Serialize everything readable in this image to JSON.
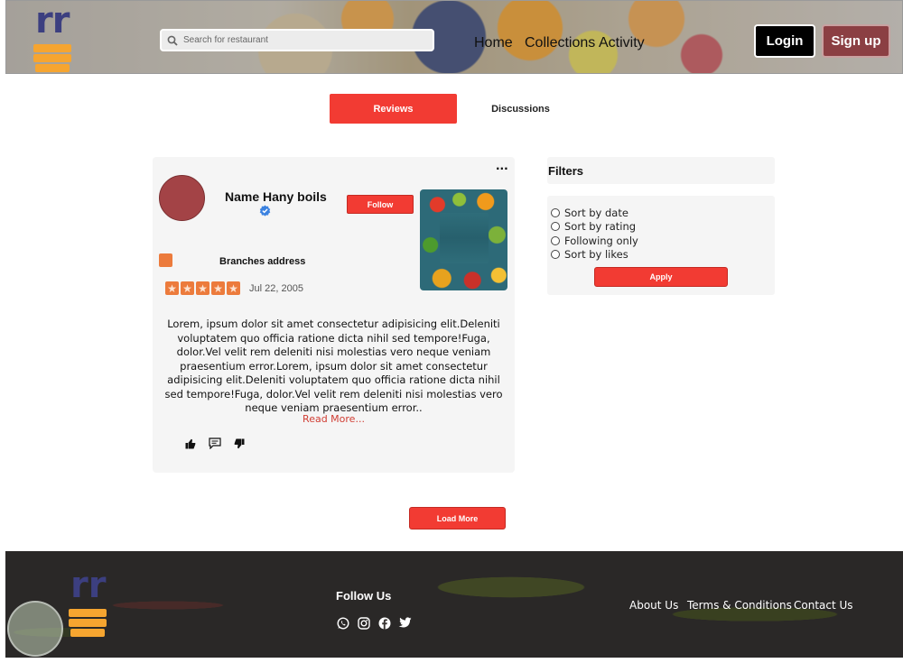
{
  "header": {
    "search_placeholder": "Search for restaurant",
    "nav": [
      "Home",
      "Collections",
      "Activity"
    ],
    "login_label": "Login",
    "signup_label": "Sign up"
  },
  "tabs": [
    {
      "label": "Reviews",
      "active": true
    },
    {
      "label": "Discussions",
      "active": false
    }
  ],
  "review": {
    "more_label": "···",
    "name": "Name Hany boils",
    "follow_label": "Follow",
    "branch_label": "Branches address",
    "rating": 5,
    "date": "Jul 22, 2005",
    "text": "Lorem, ipsum dolor sit amet consectetur adipisicing elit.Deleniti voluptatem quo officia ratione dicta nihil sed tempore!Fuga, dolor.Vel velit rem deleniti nisi molestias vero neque veniam praesentium error.Lorem, ipsum dolor sit amet consectetur adipisicing elit.Deleniti voluptatem quo officia ratione dicta nihil sed tempore!Fuga, dolor.Vel velit rem deleniti nisi molestias vero neque veniam praesentium error..",
    "read_more": "Read More..."
  },
  "filters": {
    "title": "Filters",
    "options": [
      "Sort by date",
      "Sort by rating",
      "Following only",
      "Sort by likes"
    ],
    "apply_label": "Apply"
  },
  "load_more_label": "Load More",
  "footer": {
    "follow_us": "Follow Us",
    "links": [
      "About Us",
      "Terms & Conditions",
      "Contact Us"
    ]
  },
  "colors": {
    "accent": "#f23b33",
    "star": "#ec7b3c",
    "logo_text": "#3c3f80",
    "logo_bars": "#f6a530"
  }
}
